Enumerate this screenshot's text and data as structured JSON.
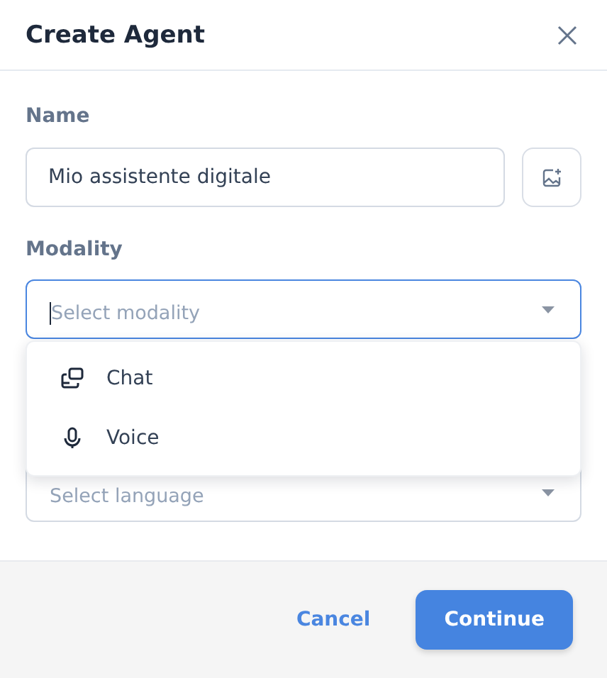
{
  "dialog": {
    "title": "Create Agent"
  },
  "name_field": {
    "label": "Name",
    "value": "Mio assistente digitale"
  },
  "modality_field": {
    "label": "Modality",
    "placeholder": "Select modality",
    "expanded": true,
    "options": [
      {
        "label": "Chat",
        "kind": "chat"
      },
      {
        "label": "Voice",
        "kind": "voice"
      }
    ]
  },
  "language_field": {
    "placeholder": "Select language"
  },
  "buttons": [
    {
      "label": "Cancel",
      "kind": "text"
    },
    {
      "label": "Continue",
      "kind": "primary"
    }
  ]
}
